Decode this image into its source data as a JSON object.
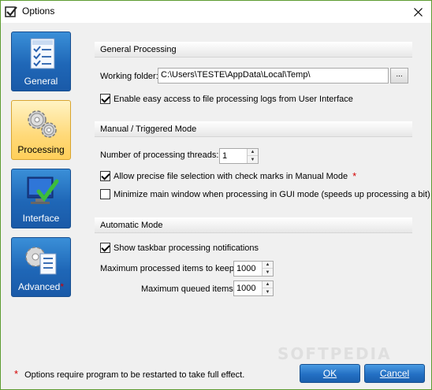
{
  "window": {
    "title": "Options",
    "close_icon": "close-icon"
  },
  "sidebar": {
    "items": [
      {
        "label": "General",
        "icon": "checklist-icon",
        "active": false
      },
      {
        "label": "Processing",
        "icon": "gears-icon",
        "active": true
      },
      {
        "label": "Interface",
        "icon": "monitor-check-icon",
        "active": false
      },
      {
        "label": "Advanced",
        "icon": "gear-document-icon",
        "active": false,
        "required_mark": "*"
      }
    ]
  },
  "general": {
    "header": "General Processing",
    "working_folder_label": "Working folder:",
    "working_folder_value": "C:\\Users\\TESTE\\AppData\\Local\\Temp\\",
    "browse_label": "...",
    "easy_access_label": "Enable easy access to file processing logs from User Interface",
    "easy_access_checked": true
  },
  "manual": {
    "header": "Manual / Triggered Mode",
    "threads_label": "Number of processing threads:",
    "threads_value": "1",
    "precise_label": "Allow precise file selection with check marks in Manual Mode",
    "precise_required_mark": "*",
    "precise_checked": true,
    "minimize_label": "Minimize main window when processing in GUI mode (speeds up processing a bit)",
    "minimize_checked": false
  },
  "automatic": {
    "header": "Automatic Mode",
    "taskbar_label": "Show taskbar processing notifications",
    "taskbar_checked": true,
    "max_keep_label": "Maximum processed items to keep:",
    "max_keep_value": "1000",
    "max_queued_label": "Maximum queued items:",
    "max_queued_value": "1000"
  },
  "footer": {
    "star": "*",
    "note": "Options require program to be restarted to take full effect.",
    "ok_label": "OK",
    "cancel_label": "Cancel",
    "watermark": "SOFTPEDIA"
  },
  "colors": {
    "accent_blue": "#2470c4",
    "active_nav": "#ffd978",
    "required_star": "#d40000",
    "window_border": "#5d9c31"
  }
}
